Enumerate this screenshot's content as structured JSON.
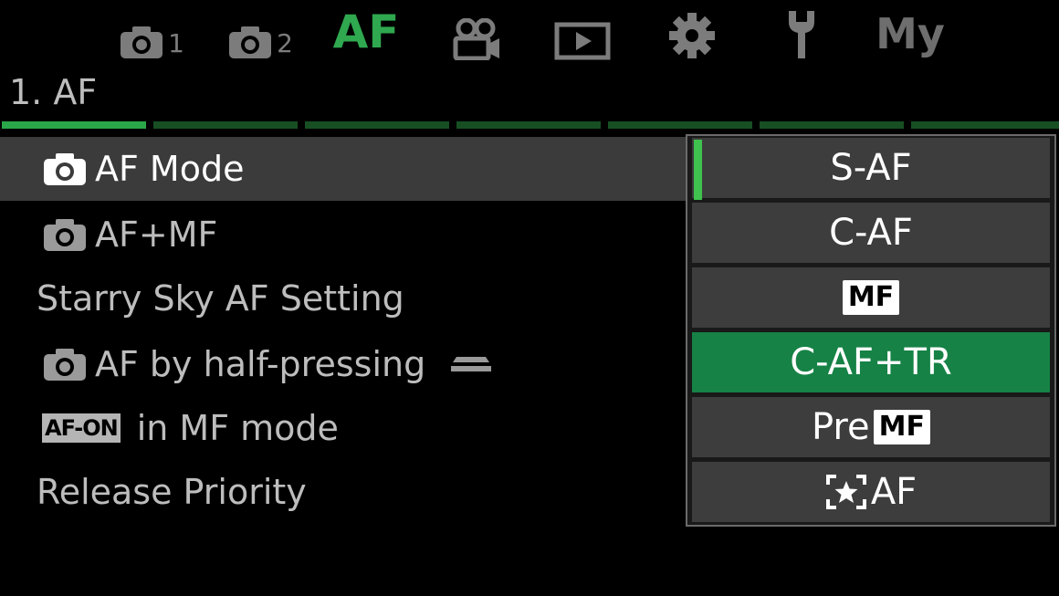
{
  "tabs": [
    {
      "name": "shooting-menu-1",
      "icon": "camera-icon",
      "sub": "1"
    },
    {
      "name": "shooting-menu-2",
      "icon": "camera-icon",
      "sub": "2"
    },
    {
      "name": "af-menu",
      "text": "AF",
      "active": true
    },
    {
      "name": "video-menu",
      "icon": "video-camera-icon"
    },
    {
      "name": "playback-menu",
      "icon": "play-icon"
    },
    {
      "name": "custom-menu",
      "icon": "gear-icon"
    },
    {
      "name": "setup-menu",
      "icon": "wrench-icon"
    },
    {
      "name": "my-menu",
      "text": "My"
    }
  ],
  "section": {
    "title": "1. AF",
    "pages_total": 7,
    "page_active": 1
  },
  "menu": {
    "items": [
      {
        "label": "AF Mode",
        "icon": "camera-icon",
        "selected": true
      },
      {
        "label": "AF+MF",
        "icon": "camera-icon"
      },
      {
        "label": "Starry Sky AF Setting"
      },
      {
        "label": "AF by half-pressing",
        "icon": "camera-icon",
        "suffix_icon": "half-press-icon"
      },
      {
        "label": "in MF mode",
        "badge": "AF-ON"
      },
      {
        "label": "Release Priority"
      }
    ]
  },
  "dropdown": {
    "options": [
      {
        "label": "S-AF",
        "current": true
      },
      {
        "label": "C-AF"
      },
      {
        "badge": "MF"
      },
      {
        "label": "C-AF+TR",
        "highlighted": true
      },
      {
        "prefix": "Pre",
        "badge": "MF"
      },
      {
        "label": "AF",
        "icon": "starry-sky-icon"
      }
    ]
  },
  "colors": {
    "accent": "#2fa84f",
    "highlight": "#168246",
    "selected_row": "#3b3b3b"
  }
}
